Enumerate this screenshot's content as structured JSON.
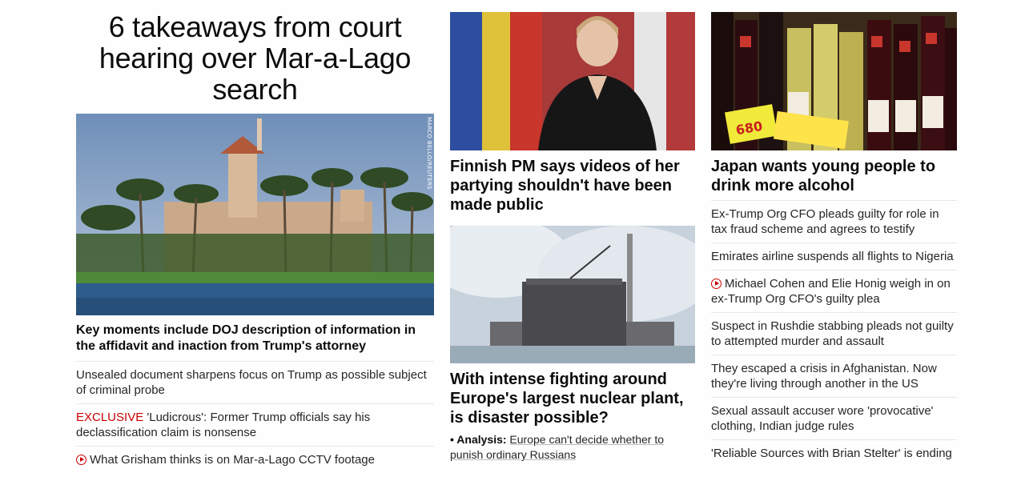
{
  "lead": {
    "title": "6 takeaways from court hearing over Mar-a-Lago search",
    "image_credit": "MARCO BELLO/REUTERS",
    "headline": "Key moments include DOJ description of information in the affidavit and inaction from Trump's attorney",
    "links": [
      {
        "text": "Unsealed document sharpens focus on Trump as possible subject of criminal probe"
      },
      {
        "prefix": "EXCLUSIVE",
        "text": " 'Ludicrous': Former Trump officials say his declassification claim is nonsense"
      },
      {
        "video": true,
        "text": "What Grisham thinks is on Mar-a-Lago CCTV footage"
      }
    ]
  },
  "middle": {
    "card1": {
      "headline": "Finnish PM says videos of her partying shouldn't have been made public"
    },
    "card2": {
      "headline": "With intense fighting around Europe's largest nuclear plant, is disaster possible?",
      "analysis_bullet": "•",
      "analysis_label": "Analysis:",
      "analysis_text": "Europe can't decide whether to punish ordinary Russians"
    }
  },
  "right": {
    "card": {
      "headline": "Japan wants young people to drink more alcohol"
    },
    "links": [
      {
        "text": "Ex-Trump Org CFO pleads guilty for role in tax fraud scheme and agrees to testify"
      },
      {
        "text": "Emirates airline suspends all flights to Nigeria"
      },
      {
        "video": true,
        "text": "Michael Cohen and Elie Honig weigh in on ex-Trump Org CFO's guilty plea"
      },
      {
        "text": "Suspect in Rushdie stabbing pleads not guilty to attempted murder and assault"
      },
      {
        "text": "They escaped a crisis in Afghanistan. Now they're living through another in the US"
      },
      {
        "text": "Sexual assault accuser wore 'provocative' clothing, Indian judge rules"
      },
      {
        "text": "'Reliable Sources with Brian Stelter' is ending"
      }
    ],
    "price_tag": "680"
  },
  "colors": {
    "accent": "#cc0000",
    "text": "#0c0c0c",
    "divider": "#e6e6e6"
  }
}
